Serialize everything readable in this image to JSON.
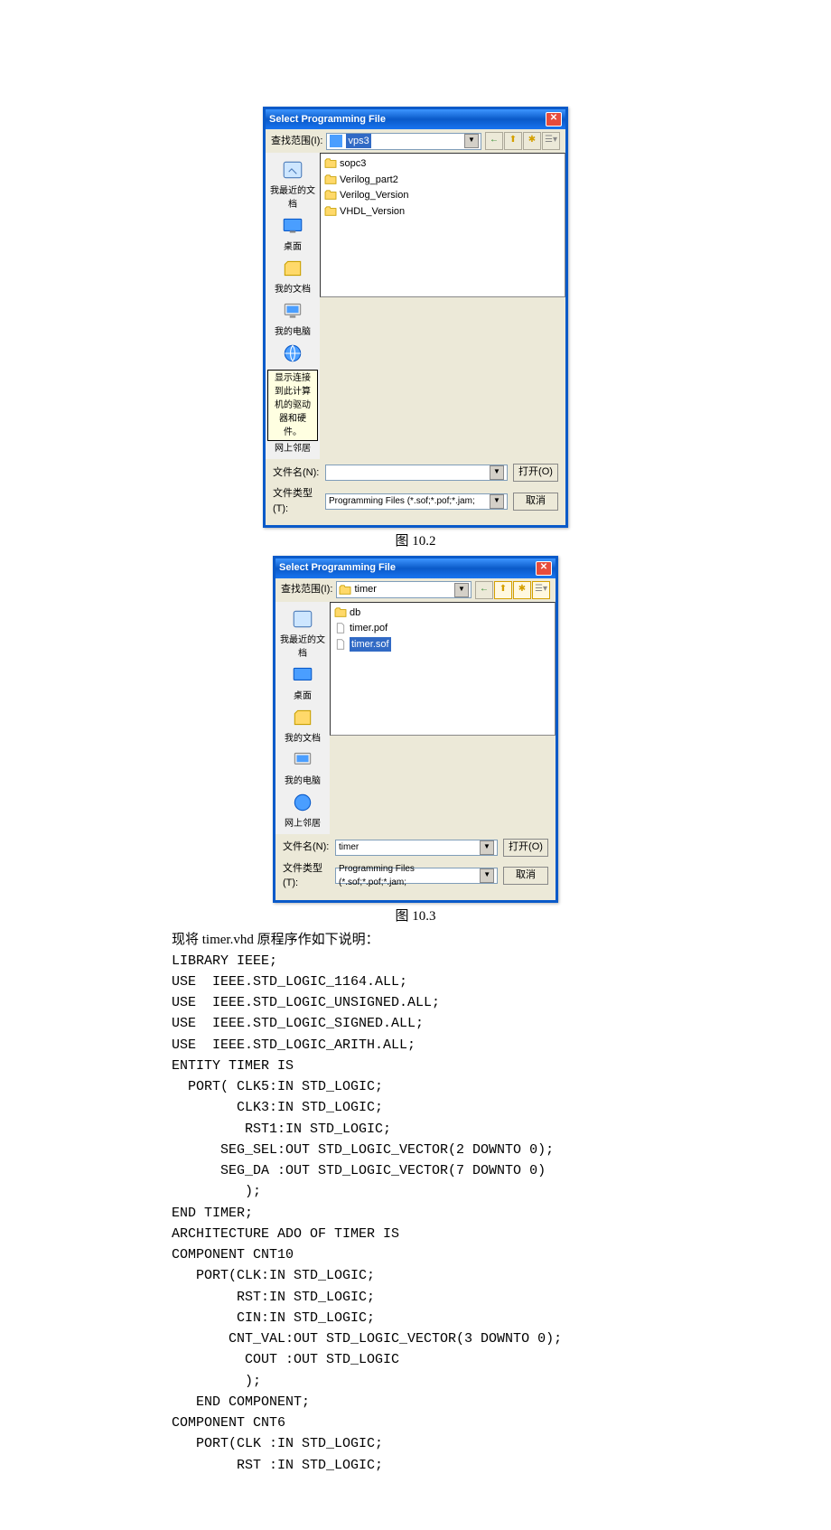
{
  "dialog1": {
    "title": "Select Programming File",
    "look_label": "查找范围(I):",
    "look_value": "vps3",
    "side": [
      "我最近的文档",
      "桌面",
      "我的文档",
      "我的电脑",
      "网上邻居"
    ],
    "files": [
      "sopc3",
      "Verilog_part2",
      "Verilog_Version",
      "VHDL_Version"
    ],
    "tooltip": "显示连接到此计算机的驱动器和硬件。",
    "filename_label": "文件名(N):",
    "filename_value": "",
    "filetype_label": "文件类型(T):",
    "filetype_value": "Programming Files (*.sof;*.pof;*.jam;",
    "open": "打开(O)",
    "cancel": "取消"
  },
  "caption1": "图 10.2",
  "dialog2": {
    "title": "Select Programming File",
    "look_label": "查找范围(I):",
    "look_value": "timer",
    "side": [
      "我最近的文档",
      "桌面",
      "我的文档",
      "我的电脑",
      "网上邻居"
    ],
    "files": [
      "db",
      "timer.pof",
      "timer.sof"
    ],
    "filename_label": "文件名(N):",
    "filename_value": "timer",
    "filetype_label": "文件类型(T):",
    "filetype_value": "Programming Files (*.sof;*.pof;*.jam;",
    "open": "打开(O)",
    "cancel": "取消"
  },
  "caption2": "图 10.3",
  "intro": "现将 timer.vhd 原程序作如下说明：",
  "code": "LIBRARY IEEE;\nUSE  IEEE.STD_LOGIC_1164.ALL;\nUSE  IEEE.STD_LOGIC_UNSIGNED.ALL;\nUSE  IEEE.STD_LOGIC_SIGNED.ALL;\nUSE  IEEE.STD_LOGIC_ARITH.ALL;\nENTITY TIMER IS\n  PORT( CLK5:IN STD_LOGIC;\n        CLK3:IN STD_LOGIC;\n         RST1:IN STD_LOGIC;\n      SEG_SEL:OUT STD_LOGIC_VECTOR(2 DOWNTO 0);\n      SEG_DA :OUT STD_LOGIC_VECTOR(7 DOWNTO 0)\n         );\nEND TIMER;\nARCHITECTURE ADO OF TIMER IS\nCOMPONENT CNT10\n   PORT(CLK:IN STD_LOGIC;\n        RST:IN STD_LOGIC;\n        CIN:IN STD_LOGIC;\n       CNT_VAL:OUT STD_LOGIC_VECTOR(3 DOWNTO 0);\n         COUT :OUT STD_LOGIC\n         );\n   END COMPONENT;\nCOMPONENT CNT6\n   PORT(CLK :IN STD_LOGIC;\n        RST :IN STD_LOGIC;"
}
